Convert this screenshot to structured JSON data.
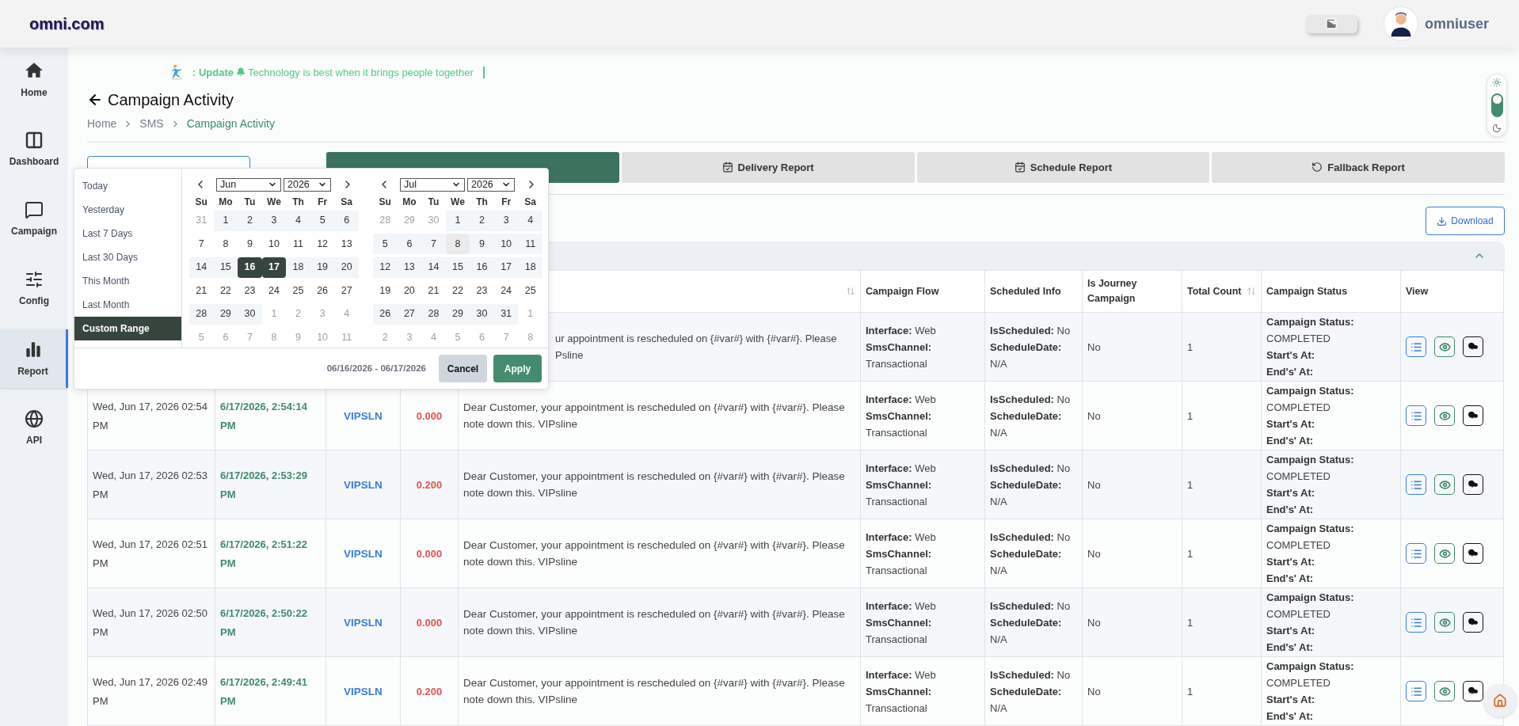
{
  "header": {
    "logo": "omni.com",
    "user": "omniuser"
  },
  "sidebar": {
    "items": [
      {
        "label": "Home",
        "selected": false
      },
      {
        "label": "Dashboard",
        "selected": false
      },
      {
        "label": "Campaign",
        "selected": false
      },
      {
        "label": "Config",
        "selected": false
      },
      {
        "label": "Report",
        "selected": true
      },
      {
        "label": "API",
        "selected": false
      }
    ]
  },
  "ticker": {
    "prefix": ": Update",
    "message": "Technology is best when it brings people together"
  },
  "page_title": "Campaign Activity",
  "breadcrumb": [
    {
      "label": "Home",
      "current": false
    },
    {
      "label": "SMS",
      "current": false
    },
    {
      "label": "Campaign Activity",
      "current": true
    }
  ],
  "tabs": [
    {
      "selected": true
    },
    {
      "label": "Delivery Report",
      "selected": false
    },
    {
      "label": "Schedule Report",
      "selected": false
    },
    {
      "label": "Fallback Report",
      "selected": false
    }
  ],
  "theme_toggle": {
    "on": true
  },
  "download_button": "Download",
  "table": {
    "columns": [
      {
        "sortable": true
      },
      {
        "label": "Campaign Flow",
        "sortable": false
      },
      {
        "label": "Scheduled Info",
        "sortable": false
      },
      {
        "label": "Is Journey Campaign",
        "sortable": false
      },
      {
        "label": "Total Count",
        "sortable": true
      },
      {
        "label": "Campaign Status",
        "sortable": false
      },
      {
        "label": "View",
        "sortable": false
      }
    ],
    "rows": [
      {
        "message_lines": [
          "ur appointment is rescheduled on {#var#} with {#var#}. Please",
          "Psline"
        ],
        "flow": [
          {
            "label": "Interface:",
            "value": "Web"
          },
          {
            "label": "SmsChannel:",
            "value": "Transactional"
          }
        ],
        "scheduled": [
          {
            "label": "IsScheduled:",
            "value": "No"
          },
          {
            "label": "ScheduleDate:",
            "value": "N/A"
          }
        ],
        "journey": "No",
        "count": "1",
        "status": [
          {
            "label": "Campaign Status:",
            "value": "COMPLETED"
          },
          {
            "label": "Start's At:"
          },
          {
            "label": "End's' At:"
          }
        ]
      },
      {
        "date": "Wed, Jun 17, 2026 02:54 PM",
        "time": "6/17/2026, 2:54:14 PM",
        "sender": "VIPSLN",
        "cost": "0.000",
        "message": "Dear Customer, your appointment is rescheduled on {#var#} with {#var#}. Please note down this. VIPsline",
        "flow": [
          {
            "label": "Interface:",
            "value": "Web"
          },
          {
            "label": "SmsChannel:",
            "value": "Transactional"
          }
        ],
        "scheduled": [
          {
            "label": "IsScheduled:",
            "value": "No"
          },
          {
            "label": "ScheduleDate:",
            "value": "N/A"
          }
        ],
        "journey": "No",
        "count": "1",
        "status": [
          {
            "label": "Campaign Status:",
            "value": "COMPLETED"
          },
          {
            "label": "Start's At:"
          },
          {
            "label": "End's' At:"
          }
        ]
      },
      {
        "date": "Wed, Jun 17, 2026 02:53 PM",
        "time": "6/17/2026, 2:53:29 PM",
        "sender": "VIPSLN",
        "cost": "0.200",
        "message": "Dear Customer, your appointment is rescheduled on {#var#} with {#var#}. Please note down this. VIPsline",
        "flow": [
          {
            "label": "Interface:",
            "value": "Web"
          },
          {
            "label": "SmsChannel:",
            "value": "Transactional"
          }
        ],
        "scheduled": [
          {
            "label": "IsScheduled:",
            "value": "No"
          },
          {
            "label": "ScheduleDate:",
            "value": "N/A"
          }
        ],
        "journey": "No",
        "count": "1",
        "status": [
          {
            "label": "Campaign Status:",
            "value": "COMPLETED"
          },
          {
            "label": "Start's At:"
          },
          {
            "label": "End's' At:"
          }
        ]
      },
      {
        "date": "Wed, Jun 17, 2026 02:51 PM",
        "time": "6/17/2026, 2:51:22 PM",
        "sender": "VIPSLN",
        "cost": "0.000",
        "message": "Dear Customer, your appointment is rescheduled on {#var#} with {#var#}. Please note down this. VIPsline",
        "flow": [
          {
            "label": "Interface:",
            "value": "Web"
          },
          {
            "label": "SmsChannel:",
            "value": "Transactional"
          }
        ],
        "scheduled": [
          {
            "label": "IsScheduled:",
            "value": "No"
          },
          {
            "label": "ScheduleDate:",
            "value": "N/A"
          }
        ],
        "journey": "No",
        "count": "1",
        "status": [
          {
            "label": "Campaign Status:",
            "value": "COMPLETED"
          },
          {
            "label": "Start's At:"
          },
          {
            "label": "End's' At:"
          }
        ]
      },
      {
        "date": "Wed, Jun 17, 2026 02:50 PM",
        "time": "6/17/2026, 2:50:22 PM",
        "sender": "VIPSLN",
        "cost": "0.000",
        "message": "Dear Customer, your appointment is rescheduled on {#var#} with {#var#}. Please note down this. VIPsline",
        "flow": [
          {
            "label": "Interface:",
            "value": "Web"
          },
          {
            "label": "SmsChannel:",
            "value": "Transactional"
          }
        ],
        "scheduled": [
          {
            "label": "IsScheduled:",
            "value": "No"
          },
          {
            "label": "ScheduleDate:",
            "value": "N/A"
          }
        ],
        "journey": "No",
        "count": "1",
        "status": [
          {
            "label": "Campaign Status:",
            "value": "COMPLETED"
          },
          {
            "label": "Start's At:"
          },
          {
            "label": "End's' At:"
          }
        ]
      },
      {
        "date": "Wed, Jun 17, 2026 02:49 PM",
        "time": "6/17/2026, 2:49:41 PM",
        "sender": "VIPSLN",
        "cost": "0.200",
        "message": "Dear Customer, your appointment is rescheduled on {#var#} with {#var#}. Please note down this. VIPsline",
        "flow": [
          {
            "label": "Interface:",
            "value": "Web"
          },
          {
            "label": "SmsChannel:",
            "value": "Transactional"
          }
        ],
        "scheduled": [
          {
            "label": "IsScheduled:",
            "value": "No"
          },
          {
            "label": "ScheduleDate:",
            "value": "N/A"
          }
        ],
        "journey": "No",
        "count": "1",
        "status": [
          {
            "label": "Campaign Status:",
            "value": "COMPLETED"
          },
          {
            "label": "Start's At:"
          },
          {
            "label": "End's' At:"
          }
        ]
      }
    ]
  },
  "date_picker": {
    "presets": [
      {
        "label": "Today",
        "selected": false
      },
      {
        "label": "Yesterday",
        "selected": false
      },
      {
        "label": "Last 7 Days",
        "selected": false
      },
      {
        "label": "Last 30 Days",
        "selected": false
      },
      {
        "label": "This Month",
        "selected": false
      },
      {
        "label": "Last Month",
        "selected": false
      },
      {
        "label": "Custom Range",
        "selected": true
      }
    ],
    "calendars": [
      {
        "month": "Jun",
        "year": "2026",
        "weekdays": [
          "Su",
          "Mo",
          "Tu",
          "We",
          "Th",
          "Fr",
          "Sa"
        ],
        "weeks": [
          [
            {
              "day": "31",
              "off": true,
              "in_range": false,
              "hover": false,
              "selected": false
            },
            {
              "day": "1",
              "off": false,
              "in_range": true,
              "hover": false,
              "selected": false
            },
            {
              "day": "2",
              "off": false,
              "in_range": true,
              "hover": false,
              "selected": false
            },
            {
              "day": "3",
              "off": false,
              "in_range": true,
              "hover": false,
              "selected": false
            },
            {
              "day": "4",
              "off": false,
              "in_range": true,
              "hover": false,
              "selected": false
            },
            {
              "day": "5",
              "off": false,
              "in_range": true,
              "hover": false,
              "selected": false
            },
            {
              "day": "6",
              "off": false,
              "in_range": true,
              "hover": false,
              "selected": false
            }
          ],
          [
            {
              "day": "7",
              "off": false,
              "in_range": false,
              "hover": false,
              "selected": false
            },
            {
              "day": "8",
              "off": false,
              "in_range": false,
              "hover": false,
              "selected": false
            },
            {
              "day": "9",
              "off": false,
              "in_range": false,
              "hover": false,
              "selected": false
            },
            {
              "day": "10",
              "off": false,
              "in_range": false,
              "hover": false,
              "selected": false
            },
            {
              "day": "11",
              "off": false,
              "in_range": false,
              "hover": false,
              "selected": false
            },
            {
              "day": "12",
              "off": false,
              "in_range": false,
              "hover": false,
              "selected": false
            },
            {
              "day": "13",
              "off": false,
              "in_range": false,
              "hover": false,
              "selected": false
            }
          ],
          [
            {
              "day": "14",
              "off": false,
              "in_range": true,
              "hover": false,
              "selected": false
            },
            {
              "day": "15",
              "off": false,
              "in_range": true,
              "hover": false,
              "selected": false
            },
            {
              "day": "16",
              "off": false,
              "in_range": true,
              "hover": false,
              "selected": true
            },
            {
              "day": "17",
              "off": false,
              "in_range": true,
              "hover": false,
              "selected": true
            },
            {
              "day": "18",
              "off": false,
              "in_range": true,
              "hover": false,
              "selected": false
            },
            {
              "day": "19",
              "off": false,
              "in_range": true,
              "hover": false,
              "selected": false
            },
            {
              "day": "20",
              "off": false,
              "in_range": true,
              "hover": false,
              "selected": false
            }
          ],
          [
            {
              "day": "21",
              "off": false,
              "in_range": false,
              "hover": false,
              "selected": false
            },
            {
              "day": "22",
              "off": false,
              "in_range": false,
              "hover": false,
              "selected": false
            },
            {
              "day": "23",
              "off": false,
              "in_range": false,
              "hover": false,
              "selected": false
            },
            {
              "day": "24",
              "off": false,
              "in_range": false,
              "hover": false,
              "selected": false
            },
            {
              "day": "25",
              "off": false,
              "in_range": false,
              "hover": false,
              "selected": false
            },
            {
              "day": "26",
              "off": false,
              "in_range": false,
              "hover": false,
              "selected": false
            },
            {
              "day": "27",
              "off": false,
              "in_range": false,
              "hover": false,
              "selected": false
            }
          ],
          [
            {
              "day": "28",
              "off": false,
              "in_range": true,
              "hover": false,
              "selected": false
            },
            {
              "day": "29",
              "off": false,
              "in_range": true,
              "hover": false,
              "selected": false
            },
            {
              "day": "30",
              "off": false,
              "in_range": true,
              "hover": false,
              "selected": false
            },
            {
              "day": "1",
              "off": true,
              "in_range": false,
              "hover": false,
              "selected": false
            },
            {
              "day": "2",
              "off": true,
              "in_range": false,
              "hover": false,
              "selected": false
            },
            {
              "day": "3",
              "off": true,
              "in_range": false,
              "hover": false,
              "selected": false
            },
            {
              "day": "4",
              "off": true,
              "in_range": false,
              "hover": false,
              "selected": false
            }
          ],
          [
            {
              "day": "5",
              "off": true,
              "in_range": false,
              "hover": false,
              "selected": false
            },
            {
              "day": "6",
              "off": true,
              "in_range": false,
              "hover": false,
              "selected": false
            },
            {
              "day": "7",
              "off": true,
              "in_range": false,
              "hover": false,
              "selected": false
            },
            {
              "day": "8",
              "off": true,
              "in_range": false,
              "hover": false,
              "selected": false
            },
            {
              "day": "9",
              "off": true,
              "in_range": false,
              "hover": false,
              "selected": false
            },
            {
              "day": "10",
              "off": true,
              "in_range": false,
              "hover": false,
              "selected": false
            },
            {
              "day": "11",
              "off": true,
              "in_range": false,
              "hover": false,
              "selected": false
            }
          ]
        ]
      },
      {
        "month": "Jul",
        "year": "2026",
        "weekdays": [
          "Su",
          "Mo",
          "Tu",
          "We",
          "Th",
          "Fr",
          "Sa"
        ],
        "weeks": [
          [
            {
              "day": "28",
              "off": true,
              "in_range": false,
              "hover": false,
              "selected": false
            },
            {
              "day": "29",
              "off": true,
              "in_range": false,
              "hover": false,
              "selected": false
            },
            {
              "day": "30",
              "off": true,
              "in_range": false,
              "hover": false,
              "selected": false
            },
            {
              "day": "1",
              "off": false,
              "in_range": true,
              "hover": false,
              "selected": false
            },
            {
              "day": "2",
              "off": false,
              "in_range": true,
              "hover": false,
              "selected": false
            },
            {
              "day": "3",
              "off": false,
              "in_range": true,
              "hover": false,
              "selected": false
            },
            {
              "day": "4",
              "off": false,
              "in_range": true,
              "hover": false,
              "selected": false
            }
          ],
          [
            {
              "day": "5",
              "off": false,
              "in_range": true,
              "hover": false,
              "selected": false
            },
            {
              "day": "6",
              "off": false,
              "in_range": true,
              "hover": false,
              "selected": false
            },
            {
              "day": "7",
              "off": false,
              "in_range": true,
              "hover": false,
              "selected": false
            },
            {
              "day": "8",
              "off": false,
              "in_range": true,
              "hover": true,
              "selected": false
            },
            {
              "day": "9",
              "off": false,
              "in_range": true,
              "hover": false,
              "selected": false
            },
            {
              "day": "10",
              "off": false,
              "in_range": true,
              "hover": false,
              "selected": false
            },
            {
              "day": "11",
              "off": false,
              "in_range": true,
              "hover": false,
              "selected": false
            }
          ],
          [
            {
              "day": "12",
              "off": false,
              "in_range": true,
              "hover": false,
              "selected": false
            },
            {
              "day": "13",
              "off": false,
              "in_range": true,
              "hover": false,
              "selected": false
            },
            {
              "day": "14",
              "off": false,
              "in_range": true,
              "hover": false,
              "selected": false
            },
            {
              "day": "15",
              "off": false,
              "in_range": true,
              "hover": false,
              "selected": false
            },
            {
              "day": "16",
              "off": false,
              "in_range": true,
              "hover": false,
              "selected": false
            },
            {
              "day": "17",
              "off": false,
              "in_range": true,
              "hover": false,
              "selected": false
            },
            {
              "day": "18",
              "off": false,
              "in_range": true,
              "hover": false,
              "selected": false
            }
          ],
          [
            {
              "day": "19",
              "off": false,
              "in_range": false,
              "hover": false,
              "selected": false
            },
            {
              "day": "20",
              "off": false,
              "in_range": false,
              "hover": false,
              "selected": false
            },
            {
              "day": "21",
              "off": false,
              "in_range": false,
              "hover": false,
              "selected": false
            },
            {
              "day": "22",
              "off": false,
              "in_range": false,
              "hover": false,
              "selected": false
            },
            {
              "day": "23",
              "off": false,
              "in_range": false,
              "hover": false,
              "selected": false
            },
            {
              "day": "24",
              "off": false,
              "in_range": false,
              "hover": false,
              "selected": false
            },
            {
              "day": "25",
              "off": false,
              "in_range": false,
              "hover": false,
              "selected": false
            }
          ],
          [
            {
              "day": "26",
              "off": false,
              "in_range": true,
              "hover": false,
              "selected": false
            },
            {
              "day": "27",
              "off": false,
              "in_range": true,
              "hover": false,
              "selected": false
            },
            {
              "day": "28",
              "off": false,
              "in_range": true,
              "hover": false,
              "selected": false
            },
            {
              "day": "29",
              "off": false,
              "in_range": true,
              "hover": false,
              "selected": false
            },
            {
              "day": "30",
              "off": false,
              "in_range": true,
              "hover": false,
              "selected": false
            },
            {
              "day": "31",
              "off": false,
              "in_range": true,
              "hover": false,
              "selected": false
            },
            {
              "day": "1",
              "off": true,
              "in_range": false,
              "hover": false,
              "selected": false
            }
          ],
          [
            {
              "day": "2",
              "off": true,
              "in_range": false,
              "hover": false,
              "selected": false
            },
            {
              "day": "3",
              "off": true,
              "in_range": false,
              "hover": false,
              "selected": false
            },
            {
              "day": "4",
              "off": true,
              "in_range": false,
              "hover": false,
              "selected": false
            },
            {
              "day": "5",
              "off": true,
              "in_range": false,
              "hover": false,
              "selected": false
            },
            {
              "day": "6",
              "off": true,
              "in_range": false,
              "hover": false,
              "selected": false
            },
            {
              "day": "7",
              "off": true,
              "in_range": false,
              "hover": false,
              "selected": false
            },
            {
              "day": "8",
              "off": true,
              "in_range": false,
              "hover": false,
              "selected": false
            }
          ]
        ]
      }
    ],
    "range_text": "06/16/2026 - 06/17/2026",
    "buttons": [
      {
        "label": "Cancel",
        "kind": "secondary"
      },
      {
        "label": "Apply",
        "kind": "primary"
      }
    ]
  }
}
